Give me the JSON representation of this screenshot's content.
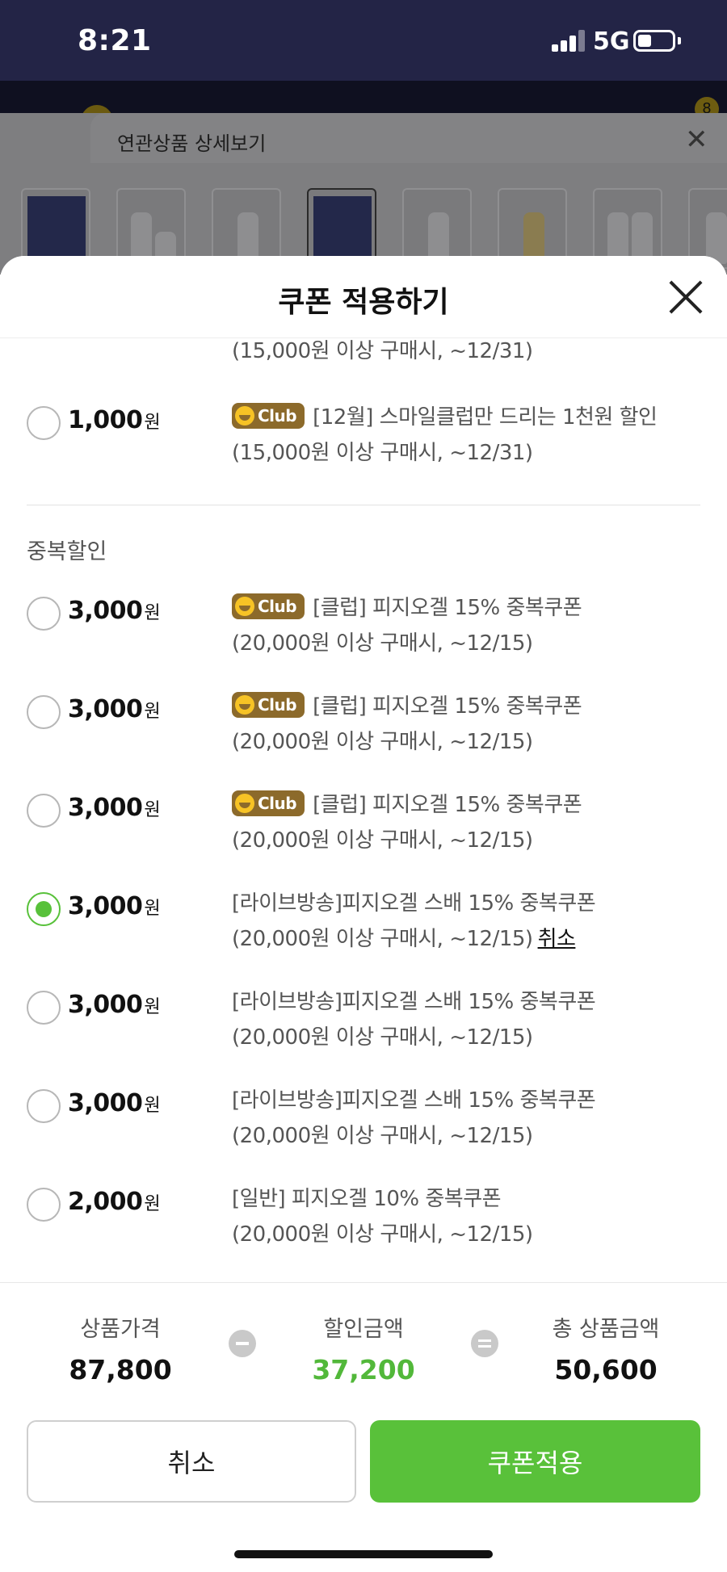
{
  "status_bar": {
    "time": "8:21",
    "network": "5G"
  },
  "background": {
    "cart_count": "8",
    "related_title": "연관상품 상세보기"
  },
  "sheet": {
    "title": "쿠폰 적용하기",
    "club_label": "Club",
    "won": "원",
    "partial_row": {
      "desc_line2": "(15,000원 이상 구매시, ~12/31)"
    },
    "basic_coupons": [
      {
        "amount": "1,000",
        "club": true,
        "title": "[12월] 스마일클럽만 드리는 1천원 할인",
        "condition": "(15,000원 이상 구매시, ~12/31)",
        "selected": false
      }
    ],
    "section_label": "중복할인",
    "dup_coupons": [
      {
        "amount": "3,000",
        "club": true,
        "title": "[클럽] 피지오겔 15% 중복쿠폰",
        "condition": "(20,000원 이상 구매시, ~12/15)",
        "selected": false
      },
      {
        "amount": "3,000",
        "club": true,
        "title": "[클럽] 피지오겔 15% 중복쿠폰",
        "condition": "(20,000원 이상 구매시, ~12/15)",
        "selected": false
      },
      {
        "amount": "3,000",
        "club": true,
        "title": "[클럽] 피지오겔 15% 중복쿠폰",
        "condition": "(20,000원 이상 구매시, ~12/15)",
        "selected": false
      },
      {
        "amount": "3,000",
        "club": false,
        "title": "[라이브방송]피지오겔 스배 15% 중복쿠폰",
        "condition": "(20,000원 이상 구매시, ~12/15)",
        "selected": true,
        "cancel_label": "취소"
      },
      {
        "amount": "3,000",
        "club": false,
        "title": "[라이브방송]피지오겔 스배 15% 중복쿠폰",
        "condition": "(20,000원 이상 구매시, ~12/15)",
        "selected": false
      },
      {
        "amount": "3,000",
        "club": false,
        "title": "[라이브방송]피지오겔 스배 15% 중복쿠폰",
        "condition": "(20,000원 이상 구매시, ~12/15)",
        "selected": false
      },
      {
        "amount": "2,000",
        "club": false,
        "title": "[일반] 피지오겔 10% 중복쿠폰",
        "condition": "(20,000원 이상 구매시, ~12/15)",
        "selected": false
      }
    ]
  },
  "summary": {
    "product_price_label": "상품가격",
    "product_price": "87,800",
    "discount_label": "할인금액",
    "discount": "37,200",
    "total_label": "총 상품금액",
    "total": "50,600"
  },
  "buttons": {
    "cancel": "취소",
    "apply": "쿠폰적용"
  },
  "colors": {
    "accent": "#59c13a",
    "club_badge": "#8c6a2b",
    "status_bar": "#232446"
  }
}
